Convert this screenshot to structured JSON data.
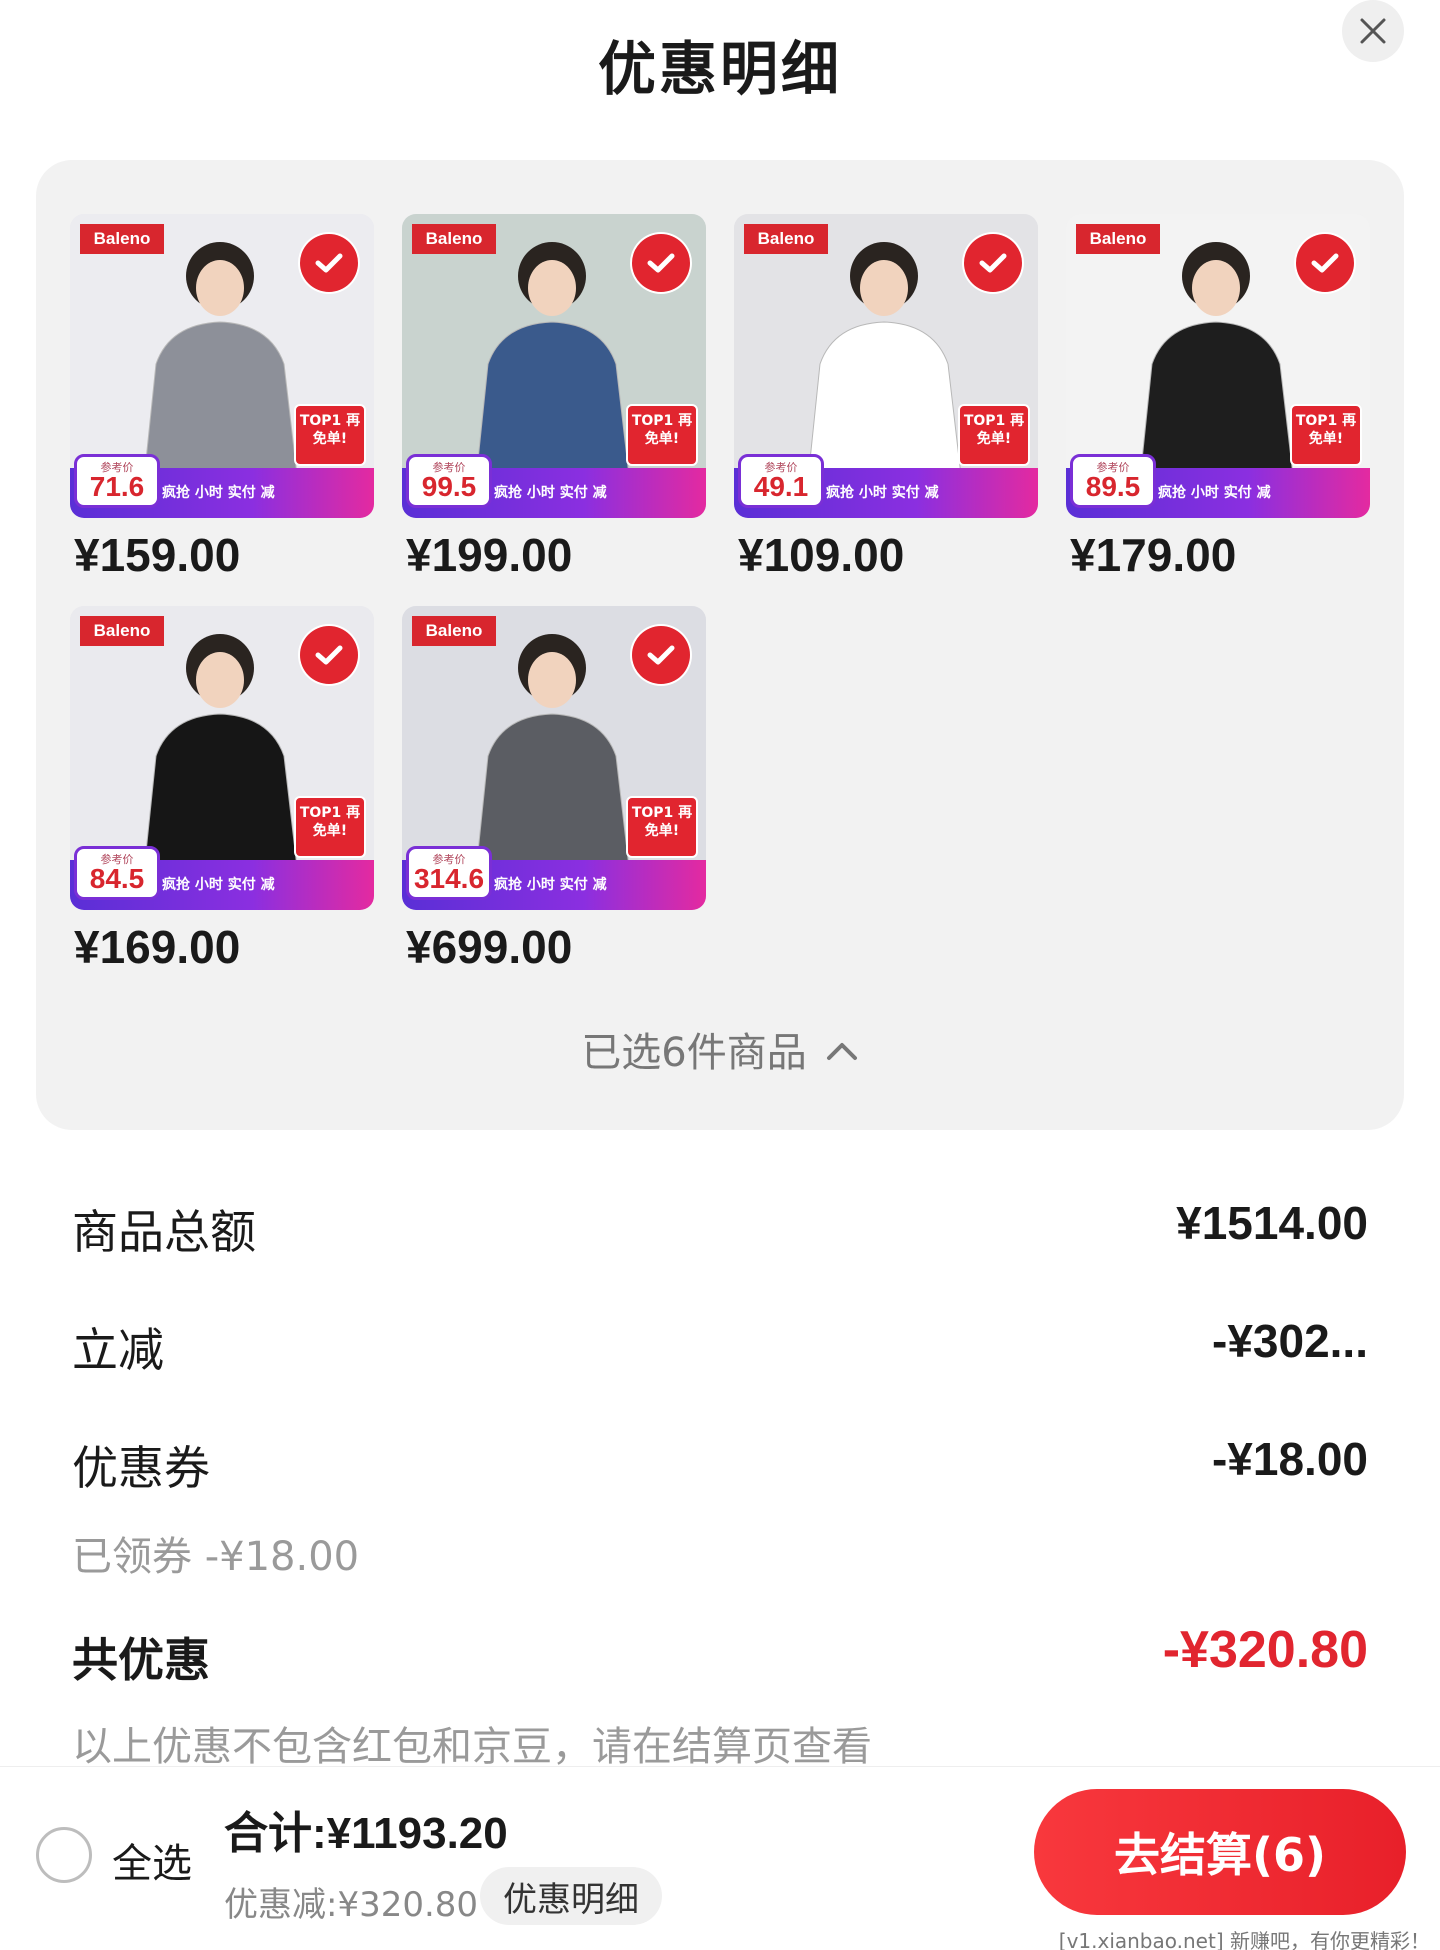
{
  "header": {
    "title": "优惠明细"
  },
  "products": [
    {
      "brand": "Baleno",
      "ref_price": "71.6",
      "price": "¥159.00",
      "ref_tag": "参考价",
      "badge": "TOP1 再免单!",
      "promo": "疯抢 小时 实付 减",
      "thumb_bg": "#ececf0",
      "garment": "#8d9099"
    },
    {
      "brand": "Baleno",
      "ref_price": "99.5",
      "price": "¥199.00",
      "ref_tag": "参考价",
      "badge": "TOP1 再免单!",
      "promo": "疯抢 小时 实付 减",
      "thumb_bg": "#c9d3cf",
      "garment": "#3a5a8c"
    },
    {
      "brand": "Baleno",
      "ref_price": "49.1",
      "price": "¥109.00",
      "ref_tag": "参考价",
      "badge": "TOP1 再免单!",
      "promo": "疯抢 小时 实付 减",
      "thumb_bg": "#e3e3e6",
      "garment": "#ffffff"
    },
    {
      "brand": "Baleno",
      "ref_price": "89.5",
      "price": "¥179.00",
      "ref_tag": "参考价",
      "badge": "TOP1 再免单!",
      "promo": "疯抢 小时 实付 减",
      "thumb_bg": "#f3f3f3",
      "garment": "#1e1e1e"
    },
    {
      "brand": "Baleno",
      "ref_price": "84.5",
      "price": "¥169.00",
      "ref_tag": "参考价",
      "badge": "TOP1 再免单!",
      "promo": "疯抢 小时 实付 减",
      "thumb_bg": "#eaeaee",
      "garment": "#161616"
    },
    {
      "brand": "Baleno",
      "ref_price": "314.6",
      "price": "¥699.00",
      "ref_tag": "参考价",
      "badge": "TOP1 再免单!",
      "promo": "疯抢 小时 实付 减",
      "thumb_bg": "#dcdde3",
      "garment": "#5b5d63"
    }
  ],
  "selection": {
    "label": "已选6件商品"
  },
  "summary": {
    "goods_total_label": "商品总额",
    "goods_total_value": "¥1514.00",
    "instant_label": "立减",
    "instant_value": "-¥302...",
    "coupon_label": "优惠券",
    "coupon_value": "-¥18.00",
    "coupon_note": "已领券 -¥18.00",
    "total_discount_label": "共优惠",
    "total_discount_value": "-¥320.80",
    "disclaimer": "以上优惠不包含红包和京豆，请在结算页查看"
  },
  "bottom_bar": {
    "select_all": "全选",
    "total": "合计:¥1193.20",
    "discount": "优惠减:¥320.80",
    "detail_button": "优惠明细",
    "checkout_button": "去结算(6)",
    "watermark": "[v1.xianbao.net] 新赚吧，有你更精彩！"
  },
  "colors": {
    "accent": "#e1252f",
    "panel": "#f2f2f2",
    "muted": "#9a9a9a"
  }
}
